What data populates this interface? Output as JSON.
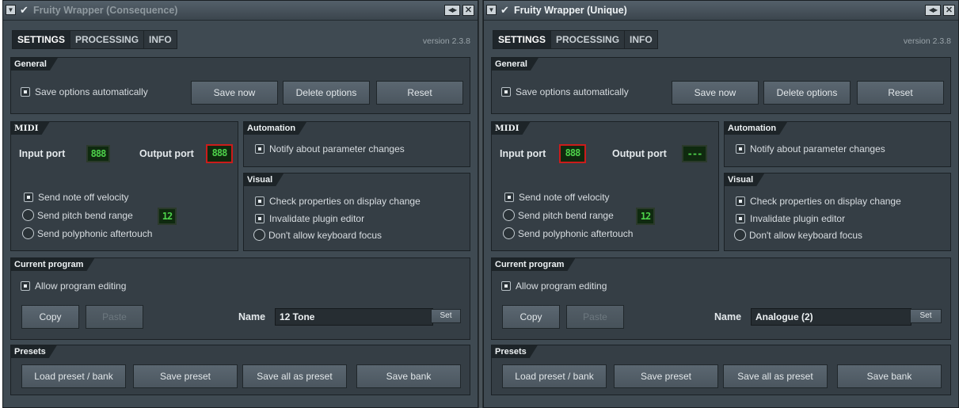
{
  "colors": {
    "window_bg": "#3f4a52",
    "panel_bg": "#353e45",
    "header_bg": "#1d2428",
    "led_green": "#4dd24a",
    "selected_port_border": "#cc1b1b"
  },
  "windows": [
    {
      "title": "Fruity Wrapper (Consequence)",
      "active": false,
      "tabs": [
        "SETTINGS",
        "PROCESSING",
        "INFO"
      ],
      "version": "version 2.3.8",
      "general": {
        "header": "General",
        "save_auto": "Save options automatically",
        "save_now": "Save now",
        "delete_options": "Delete options",
        "reset": "Reset"
      },
      "midi": {
        "header": "MIDI",
        "input_label": "Input port",
        "input_value": "888",
        "output_label": "Output port",
        "output_value": "888",
        "selected_port": "output",
        "note_off": "Send note off velocity",
        "pitch_bend": "Send pitch bend range",
        "pitch_bend_value": "12",
        "poly_aftertouch": "Send polyphonic aftertouch"
      },
      "automation": {
        "header": "Automation",
        "notify": "Notify about parameter changes"
      },
      "visual": {
        "header": "Visual",
        "check_props": "Check properties on display change",
        "invalidate": "Invalidate plugin editor",
        "no_keyboard": "Don't allow keyboard focus"
      },
      "program": {
        "header": "Current program",
        "allow_editing": "Allow program editing",
        "copy": "Copy",
        "paste": "Paste",
        "name_label": "Name",
        "name_value": "12 Tone",
        "set": "Set"
      },
      "presets": {
        "header": "Presets",
        "load": "Load preset / bank",
        "save_preset": "Save preset",
        "save_all": "Save all as preset",
        "save_bank": "Save bank"
      }
    },
    {
      "title": "Fruity Wrapper (Unique)",
      "active": true,
      "tabs": [
        "SETTINGS",
        "PROCESSING",
        "INFO"
      ],
      "version": "version 2.3.8",
      "general": {
        "header": "General",
        "save_auto": "Save options automatically",
        "save_now": "Save now",
        "delete_options": "Delete options",
        "reset": "Reset"
      },
      "midi": {
        "header": "MIDI",
        "input_label": "Input port",
        "input_value": "888",
        "output_label": "Output port",
        "output_value": "---",
        "selected_port": "input",
        "note_off": "Send note off velocity",
        "pitch_bend": "Send pitch bend range",
        "pitch_bend_value": "12",
        "poly_aftertouch": "Send polyphonic aftertouch"
      },
      "automation": {
        "header": "Automation",
        "notify": "Notify about parameter changes"
      },
      "visual": {
        "header": "Visual",
        "check_props": "Check properties on display change",
        "invalidate": "Invalidate plugin editor",
        "no_keyboard": "Don't allow keyboard focus"
      },
      "program": {
        "header": "Current program",
        "allow_editing": "Allow program editing",
        "copy": "Copy",
        "paste": "Paste",
        "name_label": "Name",
        "name_value": "Analogue (2)",
        "set": "Set"
      },
      "presets": {
        "header": "Presets",
        "load": "Load preset / bank",
        "save_preset": "Save preset",
        "save_all": "Save all as preset",
        "save_bank": "Save bank"
      }
    }
  ]
}
